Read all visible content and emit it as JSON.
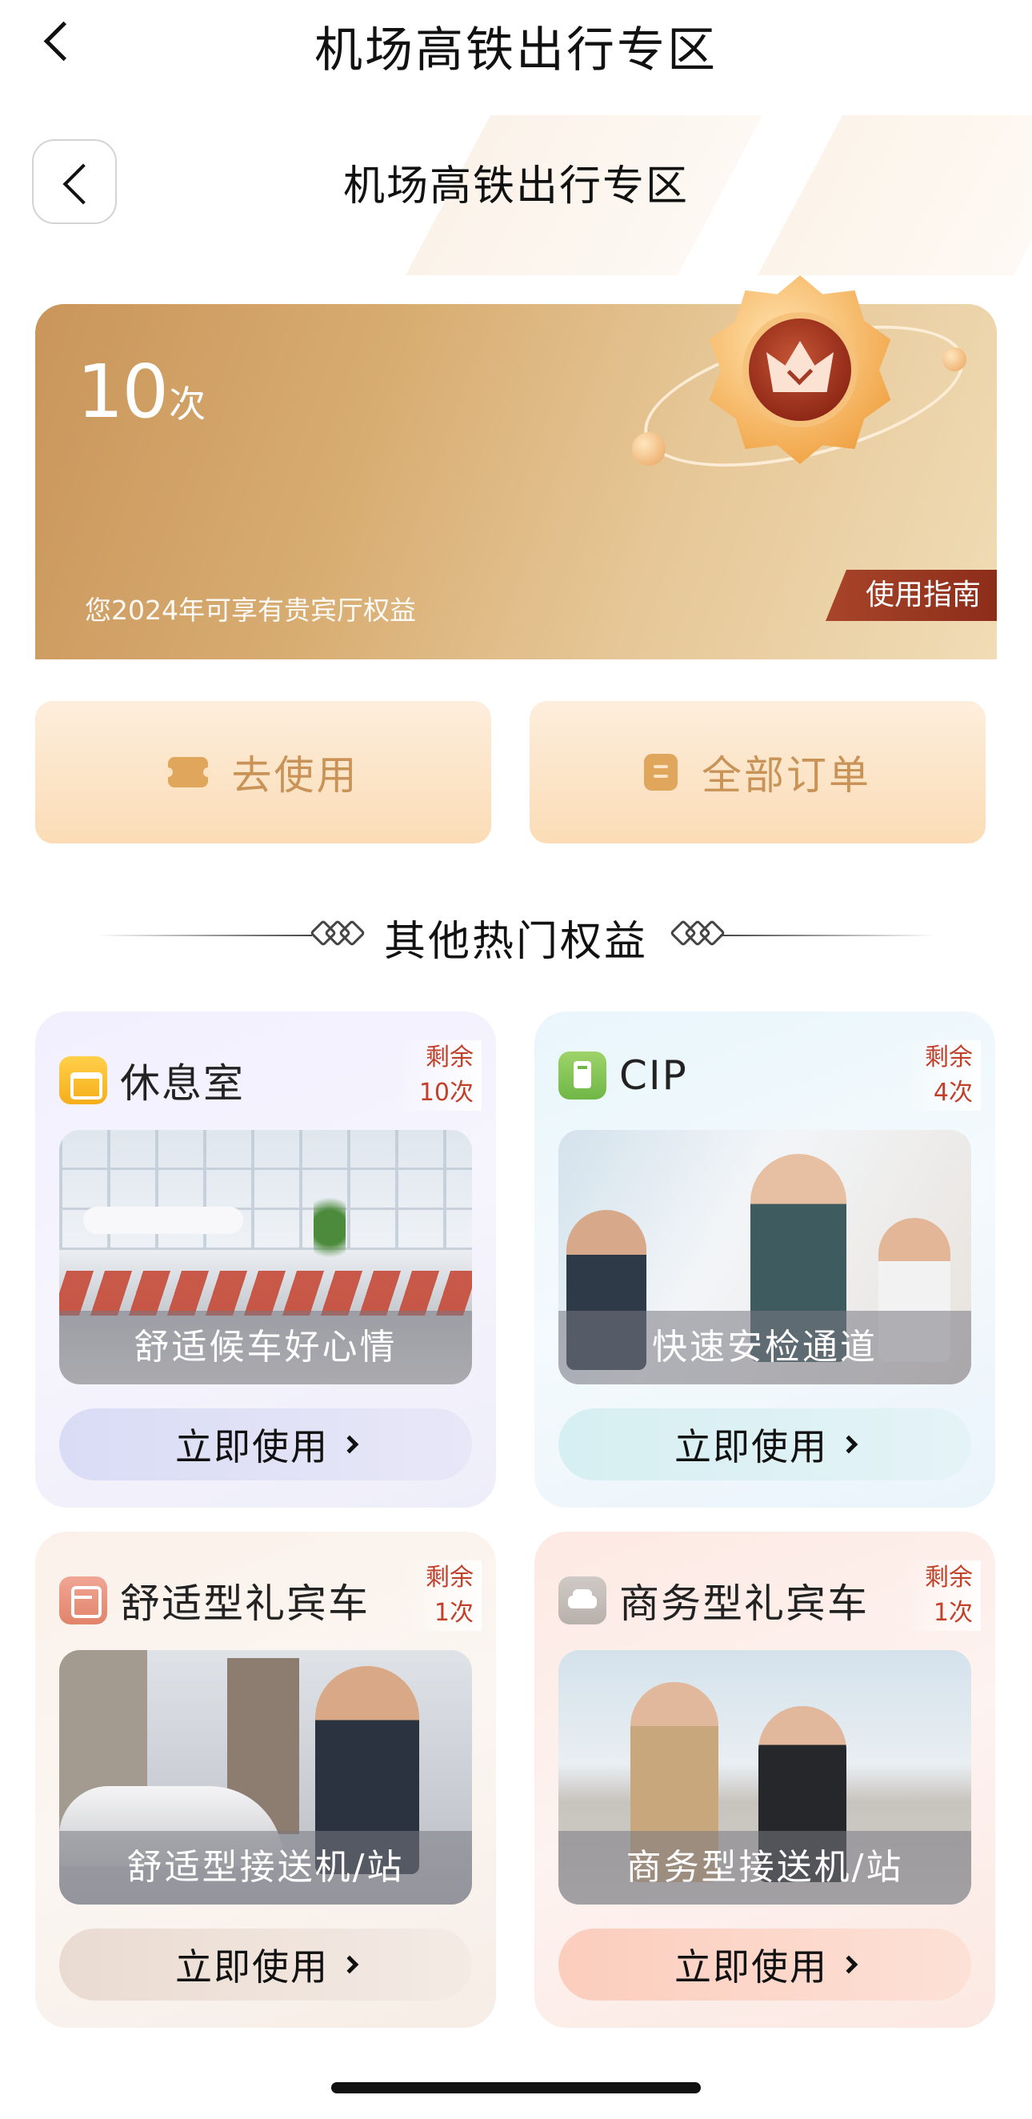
{
  "topbar": {
    "title": "机场高铁出行专区"
  },
  "inner_header": {
    "title": "机场高铁出行专区"
  },
  "summary_card": {
    "count": "10",
    "unit": "次",
    "description": "您2024年可享有贵宾厅权益",
    "guide_label": "使用指南"
  },
  "actions": {
    "use_label": "去使用",
    "orders_label": "全部订单"
  },
  "section": {
    "title": "其他热门权益"
  },
  "benefits": [
    {
      "name": "休息室",
      "remain_label": "剩余",
      "remain_count": "10次",
      "caption": "舒适候车好心情",
      "button": "立即使用",
      "icon": "sofa-icon"
    },
    {
      "name": "CIP",
      "remain_label": "剩余",
      "remain_count": "4次",
      "caption": "快速安检通道",
      "button": "立即使用",
      "icon": "cip-icon"
    },
    {
      "name": "舒适型礼宾车",
      "remain_label": "剩余",
      "remain_count": "1次",
      "caption": "舒适型接送机/站",
      "button": "立即使用",
      "icon": "bus-icon"
    },
    {
      "name": "商务型礼宾车",
      "remain_label": "剩余",
      "remain_count": "1次",
      "caption": "商务型接送机/站",
      "button": "立即使用",
      "icon": "car-icon"
    }
  ],
  "colors": {
    "gold_card": "#d8ad72",
    "guide_badge": "#a8452a",
    "action_text": "#c99358",
    "remain_text": "#c2402a"
  }
}
